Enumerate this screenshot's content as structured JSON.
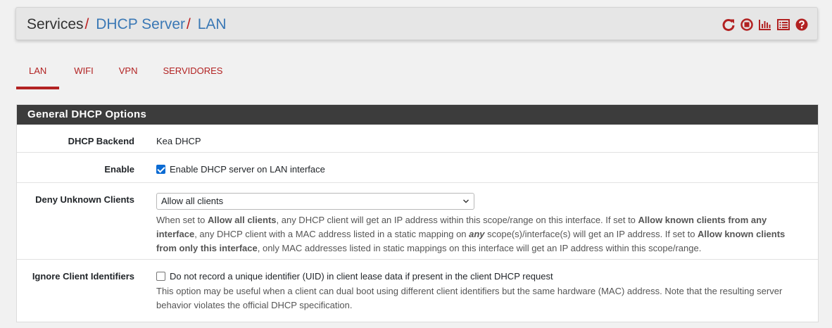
{
  "breadcrumb": {
    "root": "Services",
    "sep": "/",
    "section": "DHCP Server",
    "current": "LAN"
  },
  "header_icons": [
    "reload-icon",
    "stop-icon",
    "chart-icon",
    "list-icon",
    "help-icon"
  ],
  "tabs": [
    {
      "label": "LAN",
      "active": true
    },
    {
      "label": "WIFI",
      "active": false
    },
    {
      "label": "VPN",
      "active": false
    },
    {
      "label": "SERVIDORES",
      "active": false
    }
  ],
  "panel": {
    "title": "General DHCP Options",
    "rows": {
      "backend": {
        "label": "DHCP Backend",
        "value": "Kea DHCP"
      },
      "enable": {
        "label": "Enable",
        "checkbox_label": "Enable DHCP server on LAN interface",
        "checked": true
      },
      "deny": {
        "label": "Deny Unknown Clients",
        "selected": "Allow all clients",
        "help": {
          "t1": "When set to ",
          "b1": "Allow all clients",
          "t2": ", any DHCP client will get an IP address within this scope/range on this interface. If set to ",
          "b2": "Allow known clients from any interface",
          "t3": ", any DHCP client with a MAC address listed in a static mapping on ",
          "b3": "any",
          "t4": " scope(s)/interface(s) will get an IP address. If set to ",
          "b4": "Allow known clients from only this interface",
          "t5": ", only MAC addresses listed in static mappings on this interface will get an IP address within this scope/range."
        }
      },
      "ignore": {
        "label": "Ignore Client Identifiers",
        "checkbox_label": "Do not record a unique identifier (UID) in client lease data if present in the client DHCP request",
        "checked": false,
        "help": "This option may be useful when a client can dual boot using different client identifiers but the same hardware (MAC) address. Note that the resulting server behavior violates the official DHCP specification."
      }
    }
  },
  "colors": {
    "accent": "#b22222",
    "link": "#3a78b5",
    "heading_bg": "#3c3c3c"
  }
}
